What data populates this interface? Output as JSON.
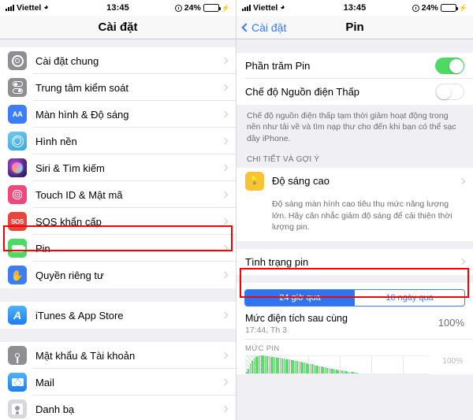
{
  "statusbar": {
    "carrier": "Viettel",
    "time": "13:45",
    "battery_percent": "24%",
    "wifi_icon": "wifi-icon",
    "signal_icon": "cellular-signal-icon",
    "alarm_icon": "alarm-clock-icon",
    "charging_icon": "lightning-bolt-icon",
    "battery_level": 24
  },
  "left_screen": {
    "nav_title": "Cài đặt",
    "groups": [
      {
        "items": [
          {
            "label": "Cài đặt chung",
            "icon": "gear-icon"
          },
          {
            "label": "Trung tâm kiểm soát",
            "icon": "control-center-icon"
          },
          {
            "label": "Màn hình & Độ sáng",
            "icon": "display-brightness-icon"
          },
          {
            "label": "Hình nền",
            "icon": "wallpaper-icon"
          },
          {
            "label": "Siri & Tìm kiếm",
            "icon": "siri-icon"
          },
          {
            "label": "Touch ID & Mật mã",
            "icon": "fingerprint-icon"
          },
          {
            "label": "SOS khẩn cấp",
            "icon": "sos-icon"
          },
          {
            "label": "Pin",
            "icon": "battery-icon"
          },
          {
            "label": "Quyền riêng tư",
            "icon": "privacy-hand-icon"
          }
        ]
      },
      {
        "items": [
          {
            "label": "iTunes & App Store",
            "icon": "app-store-icon"
          }
        ]
      },
      {
        "items": [
          {
            "label": "Mật khẩu & Tài khoản",
            "icon": "key-icon"
          },
          {
            "label": "Mail",
            "icon": "mail-icon"
          },
          {
            "label": "Danh bạ",
            "icon": "contacts-icon"
          }
        ]
      }
    ],
    "highlight_label": "Pin"
  },
  "right_screen": {
    "nav_back_label": "Cài đặt",
    "nav_title": "Pin",
    "toggles": [
      {
        "label": "Phần trăm Pin",
        "state": "on",
        "name": "battery-percentage-toggle"
      },
      {
        "label": "Chế độ Nguồn điện Thấp",
        "state": "off",
        "name": "low-power-mode-toggle"
      }
    ],
    "low_power_footnote": "Chế độ nguồn điện thấp tạm thời giảm hoạt động trong nền như tải về và tìm nạp thư cho đến khi bạn có thể sạc đầy iPhone.",
    "tips_section_header": "CHI TIẾT VÀ GỢI Ý",
    "tip": {
      "label": "Độ sáng cao",
      "icon": "lightbulb-icon",
      "footnote": "Độ sáng màn hình cao tiêu thụ mức năng lượng lớn. Hãy cân nhắc giảm độ sáng để cải thiện thời lượng pin."
    },
    "battery_health_label": "Tình trạng pin",
    "highlight_label": "Tình trạng pin",
    "segmented": {
      "options": [
        "24 giờ qua",
        "10 ngày qua"
      ],
      "selected_index": 0
    },
    "last_charge": {
      "title": "Mức điện tích sau cùng",
      "subtitle": "17:44, Th 3",
      "percent": "100%"
    },
    "chart": {
      "header": "MỨC PIN",
      "axis_max_label": "100%"
    }
  },
  "colors": {
    "accent_blue": "#3b7ef5",
    "segment_blue": "#2f73ef",
    "toggle_green": "#4cd964",
    "highlight_red": "#f40000",
    "chart_green": "#63d86f",
    "group_bg": "#efeff4"
  },
  "chart_data": {
    "type": "bar",
    "title": "MỨC PIN",
    "xlabel": "",
    "ylabel": "",
    "ylim": [
      0,
      100
    ],
    "axis_max_label": "100%",
    "grid": true,
    "categories": [
      "0",
      "1",
      "2",
      "3",
      "4",
      "5",
      "6",
      "7",
      "8",
      "9",
      "10",
      "11",
      "12",
      "13",
      "14",
      "15",
      "16",
      "17",
      "18",
      "19",
      "20",
      "21",
      "22",
      "23",
      "24",
      "25",
      "26",
      "27",
      "28",
      "29",
      "30",
      "31",
      "32",
      "33",
      "34",
      "35",
      "36",
      "37",
      "38",
      "39",
      "40",
      "41",
      "42",
      "43",
      "44",
      "45",
      "46",
      "47",
      "48",
      "49",
      "50",
      "51",
      "52",
      "53",
      "54",
      "55",
      "56",
      "57",
      "58",
      "59"
    ],
    "values": [
      10,
      26,
      52,
      70,
      82,
      90,
      96,
      99,
      100,
      98,
      97,
      95,
      94,
      92,
      91,
      89,
      88,
      86,
      85,
      83,
      81,
      80,
      78,
      76,
      74,
      72,
      70,
      68,
      66,
      63,
      61,
      59,
      57,
      54,
      52,
      50,
      47,
      45,
      43,
      40,
      38,
      36,
      33,
      31,
      29,
      27,
      25,
      23,
      21,
      19,
      17,
      15,
      13,
      12,
      10,
      9,
      8,
      7,
      6,
      5
    ]
  }
}
